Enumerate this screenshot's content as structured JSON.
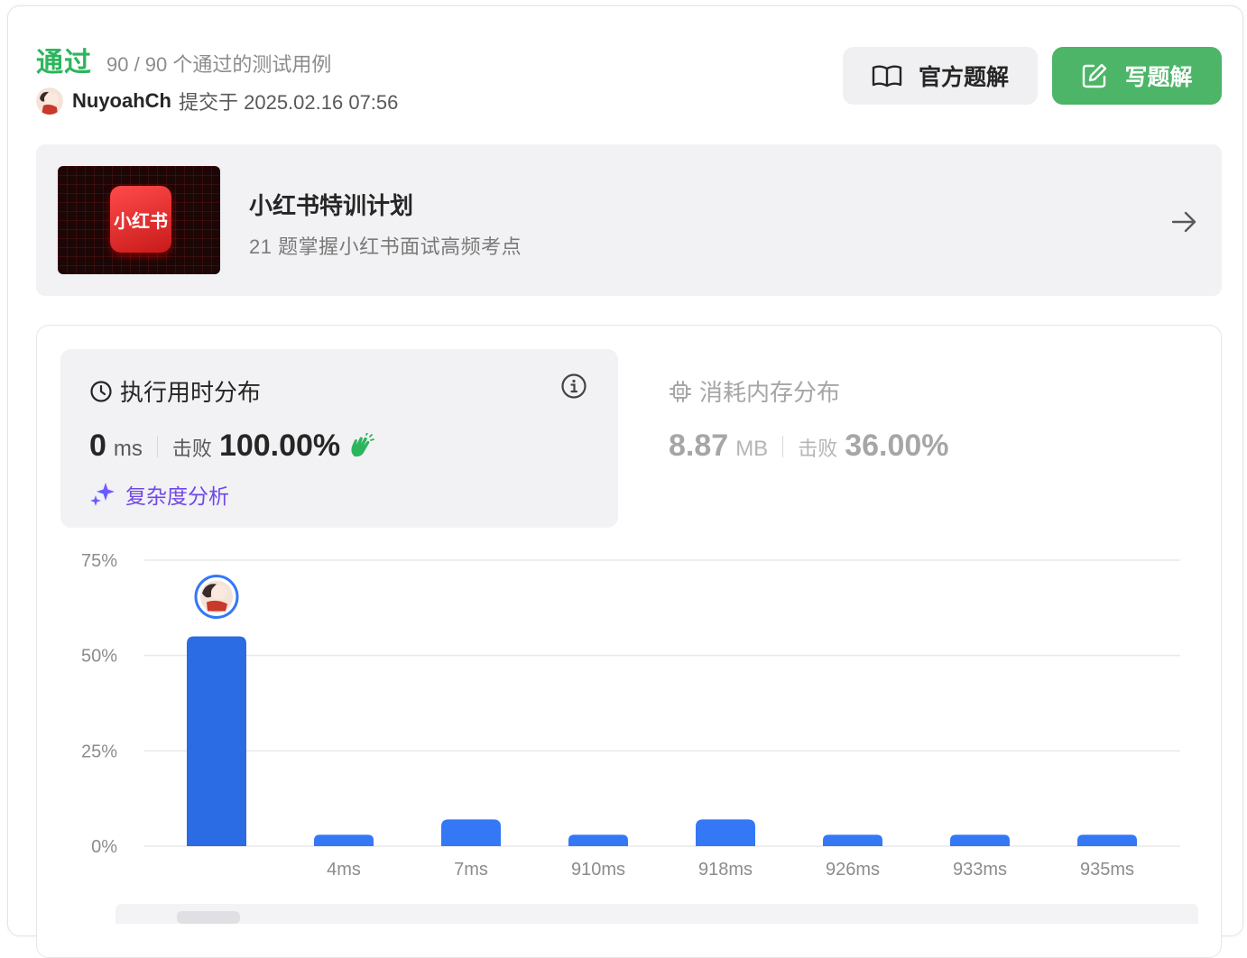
{
  "header": {
    "status": "通过",
    "cases": "90 / 90 个通过的测试用例",
    "username": "NuyoahCh",
    "submitted": "提交于 2025.02.16 07:56"
  },
  "buttons": {
    "official": "官方题解",
    "write": "写题解"
  },
  "promo": {
    "logo_text": "小红书",
    "title": "小红书特训计划",
    "subtitle": "21 题掌握小红书面试高频考点"
  },
  "runtime": {
    "title": "执行用时分布",
    "value": "0",
    "unit": "ms",
    "beat_label": "击败",
    "beat_pct": "100.00%",
    "analysis": "复杂度分析"
  },
  "memory": {
    "title": "消耗内存分布",
    "value": "8.87",
    "unit": "MB",
    "beat_label": "击败",
    "beat_pct": "36.00%"
  },
  "colors": {
    "accent_green": "#2db55d",
    "button_green": "#4cb567",
    "bar_blue": "#3478f6",
    "complexity_purple": "#7048e8"
  },
  "chart_data": {
    "type": "bar",
    "categories": [
      "",
      "4ms",
      "7ms",
      "910ms",
      "918ms",
      "926ms",
      "933ms",
      "935ms"
    ],
    "values": [
      55,
      3,
      7,
      3,
      7,
      3,
      3,
      3
    ],
    "highlight_index": 0,
    "ylim": [
      0,
      75
    ],
    "yticks": [
      "0%",
      "25%",
      "50%",
      "75%"
    ],
    "ytick_values": [
      0,
      25,
      50,
      75
    ],
    "grid": true
  }
}
